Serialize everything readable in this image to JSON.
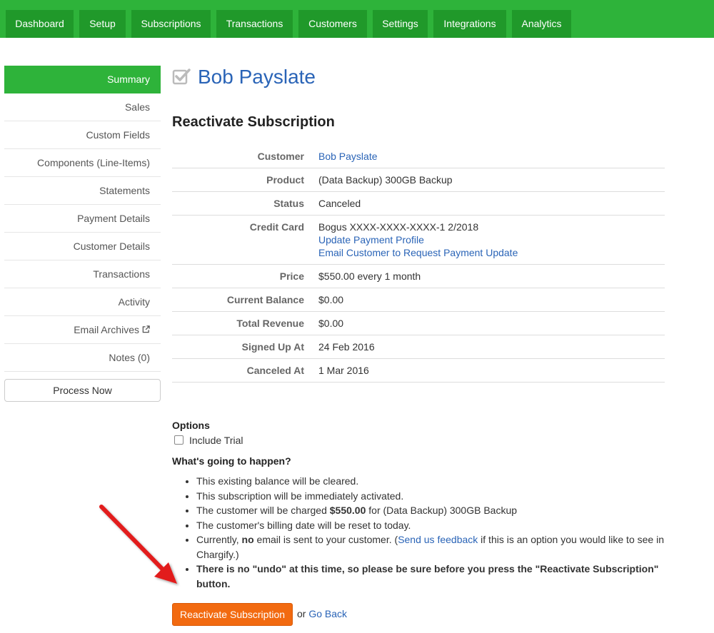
{
  "nav": {
    "tabs": [
      "Dashboard",
      "Setup",
      "Subscriptions",
      "Transactions",
      "Customers",
      "Settings",
      "Integrations",
      "Analytics"
    ]
  },
  "sidebar": {
    "items": [
      "Summary",
      "Sales",
      "Custom Fields",
      "Components (Line-Items)",
      "Statements",
      "Payment Details",
      "Customer Details",
      "Transactions",
      "Activity",
      "Email Archives",
      "Notes (0)"
    ],
    "process_now": "Process Now"
  },
  "header": {
    "customer_name": "Bob Payslate",
    "section_title": "Reactivate Subscription"
  },
  "details": {
    "customer_label": "Customer",
    "customer_value": "Bob Payslate",
    "product_label": "Product",
    "product_value": "(Data Backup) 300GB Backup",
    "status_label": "Status",
    "status_value": "Canceled",
    "card_label": "Credit Card",
    "card_value": "Bogus XXXX-XXXX-XXXX-1 2/2018",
    "update_payment_link": "Update Payment Profile",
    "email_customer_link": "Email Customer to Request Payment Update",
    "price_label": "Price",
    "price_value": "$550.00 every 1 month",
    "balance_label": "Current Balance",
    "balance_value": "$0.00",
    "revenue_label": "Total Revenue",
    "revenue_value": "$0.00",
    "signed_label": "Signed Up At",
    "signed_value": "24 Feb 2016",
    "canceled_label": "Canceled At",
    "canceled_value": "1 Mar 2016"
  },
  "options": {
    "heading": "Options",
    "include_trial": "Include Trial",
    "what_heading": "What's going to happen?",
    "b1": "This existing balance will be cleared.",
    "b2": "This subscription will be immediately activated.",
    "b3_pre": "The customer will be charged ",
    "b3_amount": "$550.00",
    "b3_post": " for (Data Backup) 300GB Backup",
    "b4": "The customer's billing date will be reset to today.",
    "b5_pre": "Currently, ",
    "b5_no": "no",
    "b5_mid": " email is sent to your customer. (",
    "b5_link": "Send us feedback",
    "b5_post": " if this is an option you would like to see in Chargify.)",
    "b6": "There is no \"undo\" at this time, so please be sure before you press the \"Reactivate Subscription\" button."
  },
  "actions": {
    "reactivate": "Reactivate Subscription",
    "or": "or",
    "go_back": "Go Back"
  },
  "colors": {
    "topbar": "#2eb33a",
    "tab": "#20992a",
    "link": "#2a64b7",
    "primary_button": "#f26a10",
    "annotation_arrow": "#e21d1d"
  }
}
